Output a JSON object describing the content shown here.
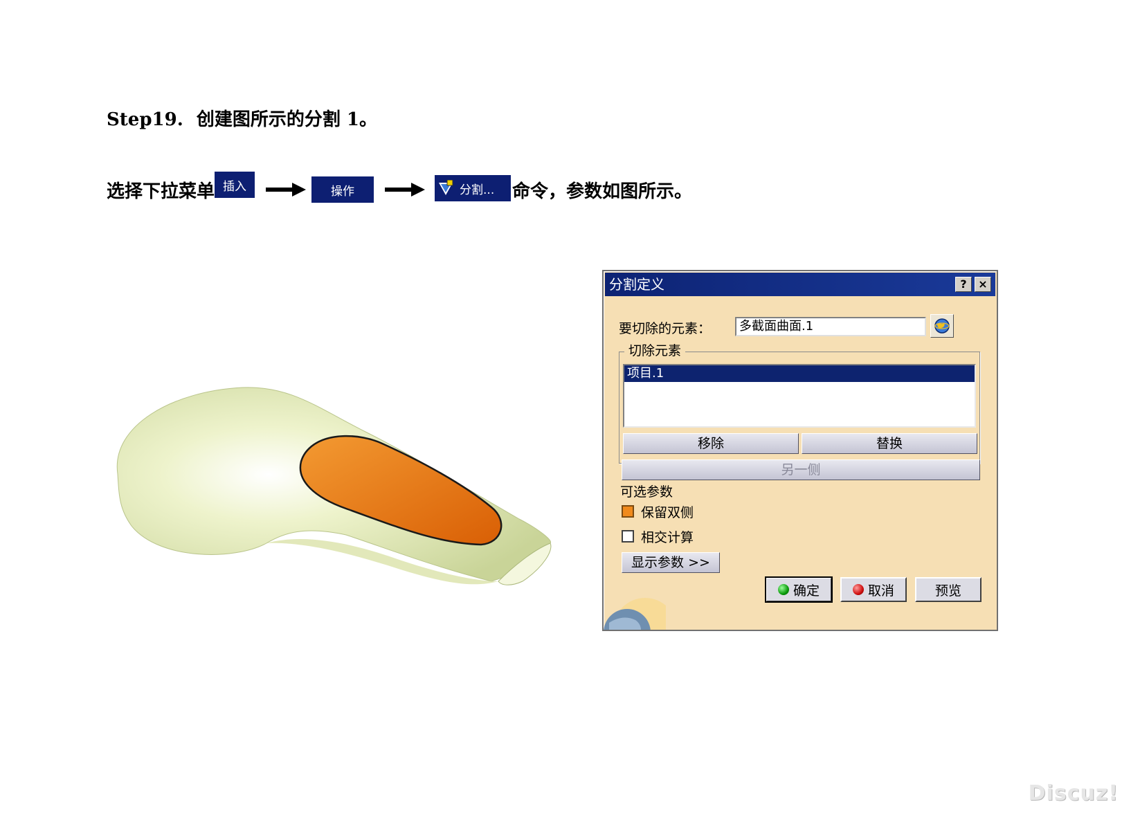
{
  "heading": {
    "step": "Step19.",
    "title": "创建图所示的分割 1。"
  },
  "instruction": {
    "prefix": "选择下拉菜单",
    "menu_insert": "插入",
    "menu_operation": "操作",
    "menu_split": "分割...",
    "suffix": "命令，参数如图所示。"
  },
  "dialog": {
    "title": "分割定义",
    "help_label": "?",
    "close_label": "×",
    "element_to_cut_label": "要切除的元素：",
    "element_to_cut_value": "多截面曲面.1",
    "cutting_elements_group": "切除元素",
    "cutting_elements": [
      "项目.1"
    ],
    "remove_button": "移除",
    "replace_button": "替换",
    "other_side_button": "另一侧",
    "optional_params_label": "可选参数",
    "keep_both_sides_label": "保留双侧",
    "keep_both_sides_checked": true,
    "intersections_label": "相交计算",
    "intersections_checked": false,
    "show_params_button": "显示参数 >>",
    "ok_button": "确定",
    "cancel_button": "取消",
    "preview_button": "预览"
  },
  "colors": {
    "surface": "#e8efc0",
    "cut_face": "#e8720c",
    "menu_chip": "#0d1f72",
    "dialog_bg": "#f6dfb4",
    "titlebar": "#0d2374"
  },
  "watermark": "Discuz!"
}
